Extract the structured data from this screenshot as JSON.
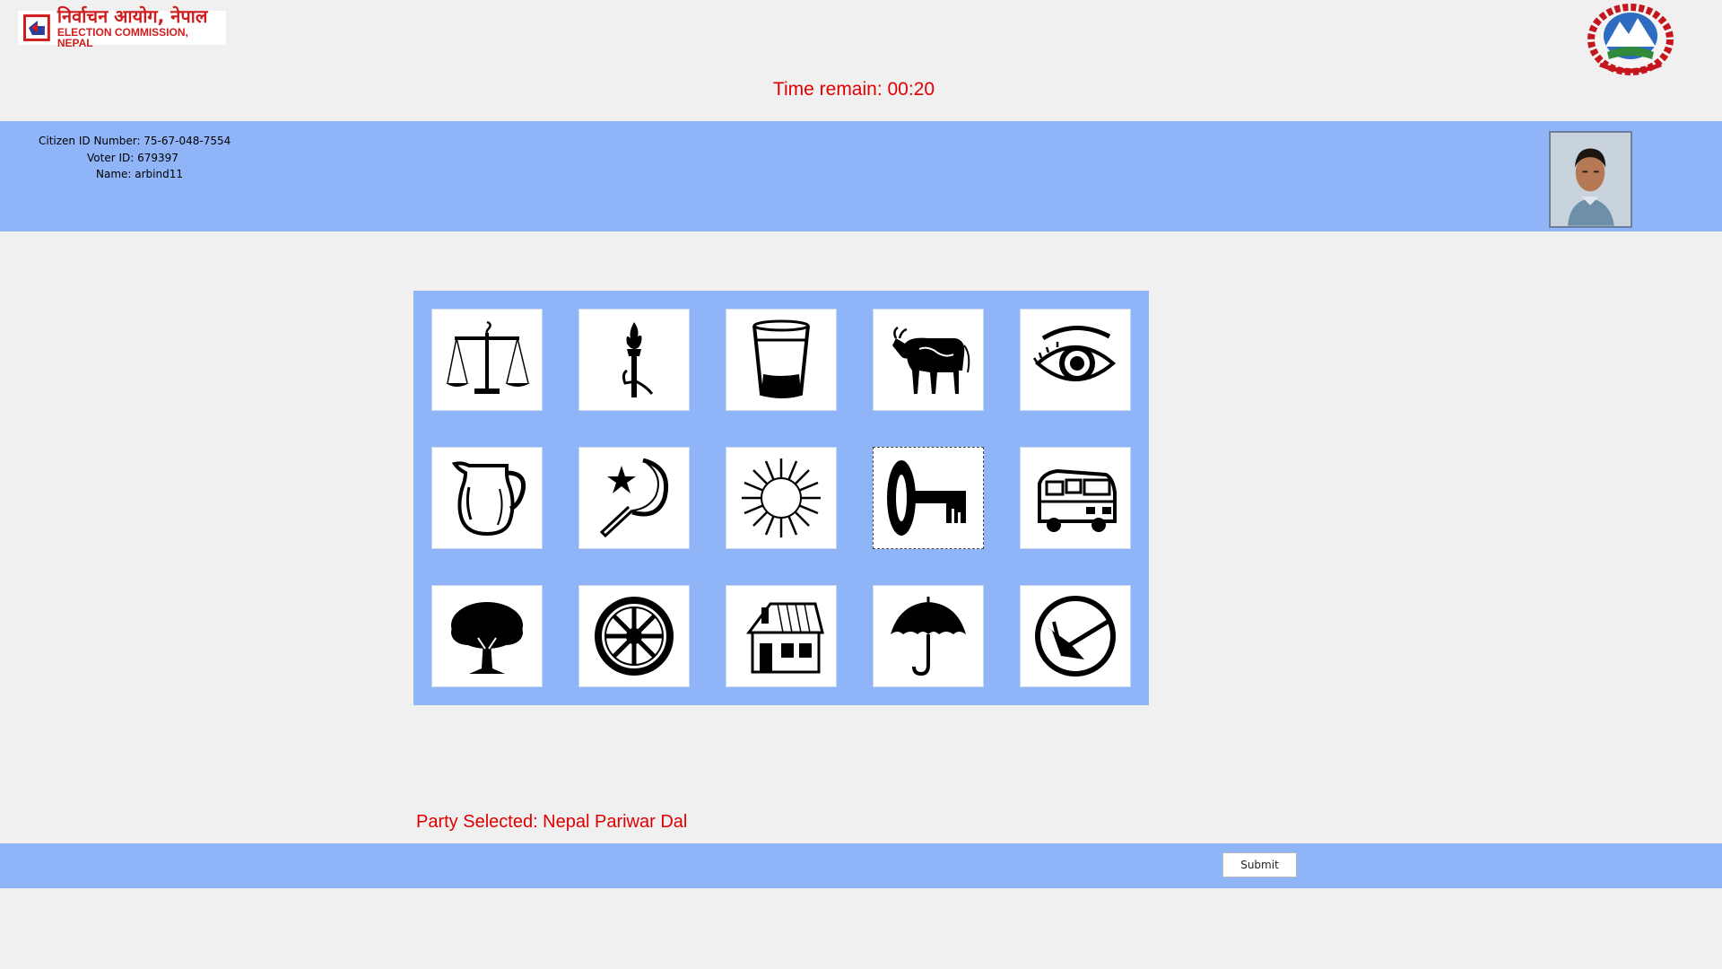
{
  "header": {
    "logo_devanagari": "निर्वाचन आयोग, नेपाल",
    "logo_english": "ELECTION COMMISSION, NEPAL",
    "timer_text": "Time remain: 00:20"
  },
  "voter": {
    "citizen_id": "Citizen ID Number: 75-67-048-7554",
    "voter_id": "Voter ID: 679397",
    "name": "Name: arbind11"
  },
  "ballot": {
    "symbols": [
      "scales-icon",
      "torch-icon",
      "glass-icon",
      "cow-icon",
      "eye-icon",
      "jug-icon",
      "sickle-star-icon",
      "sun-icon",
      "key-icon",
      "bus-icon",
      "tree-icon",
      "wheel-icon",
      "house-icon",
      "umbrella-icon",
      "plough-icon"
    ],
    "selected_symbol": "key-icon"
  },
  "selection": {
    "text": "Party Selected: Nepal Pariwar Dal"
  },
  "footer": {
    "submit_label": "Submit"
  },
  "colors": {
    "band": "#8fb4f7",
    "accent_red": "#e00000",
    "page_bg": "#f0f0f0"
  }
}
